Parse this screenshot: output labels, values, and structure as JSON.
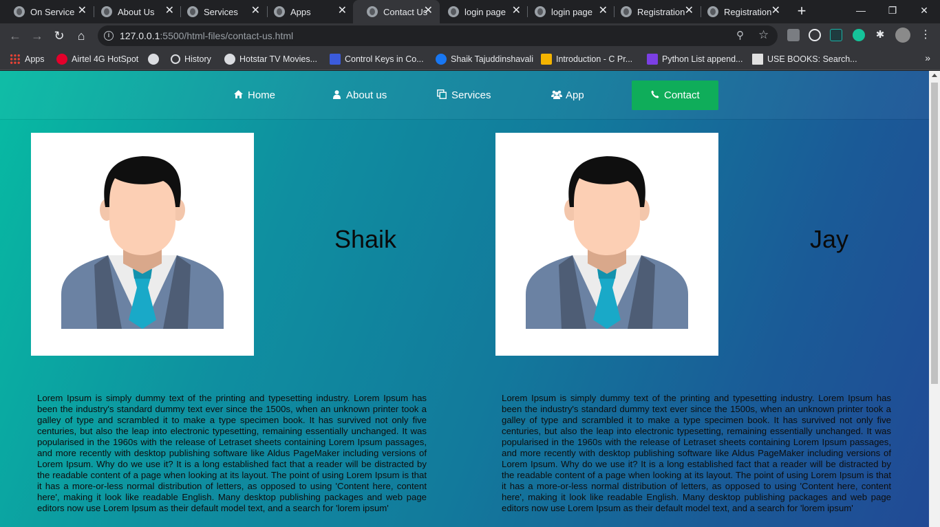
{
  "browser": {
    "tabs": [
      {
        "title": "On Service"
      },
      {
        "title": "About Us"
      },
      {
        "title": "Services"
      },
      {
        "title": "Apps"
      },
      {
        "title": "Contact Us",
        "active": true
      },
      {
        "title": "login page"
      },
      {
        "title": "login page"
      },
      {
        "title": "Registration"
      },
      {
        "title": "Registration"
      }
    ],
    "new_tab": "+",
    "window": {
      "minimize": "—",
      "restore": "❐",
      "close": "✕"
    },
    "url_host": "127.0.0.1",
    "url_path": ":5500/html-files/contact-us.html",
    "bookmarks": [
      {
        "label": "Apps",
        "icon": "apps-grid-icon"
      },
      {
        "label": "Airtel 4G HotSpot",
        "icon": "airtel-icon",
        "color": "#e4002b"
      },
      {
        "label": "",
        "icon": "globe-icon",
        "color": "#9aa0a6"
      },
      {
        "label": "History",
        "icon": "history-icon",
        "color": "#9aa0a6"
      },
      {
        "label": "Hotstar TV Movies...",
        "icon": "globe-icon",
        "color": "#9aa0a6"
      },
      {
        "label": "Control Keys in Co...",
        "icon": "control-keys-icon",
        "color": "#3b5bdb"
      },
      {
        "label": "Shaik Tajuddinshavali",
        "icon": "facebook-icon",
        "color": "#1877f2"
      },
      {
        "label": "Introduction - C Pr...",
        "icon": "javatpoint-icon",
        "color": "#f4b400"
      },
      {
        "label": "Python List append...",
        "icon": "python-list-icon",
        "color": "#7b3fe4"
      },
      {
        "label": "USE BOOKS: Search...",
        "icon": "books-icon",
        "color": "#e0e0e0"
      }
    ],
    "more_bookmarks": "»"
  },
  "site": {
    "nav": [
      {
        "label": "Home",
        "icon": "home-icon"
      },
      {
        "label": "About us",
        "icon": "user-icon"
      },
      {
        "label": "Services",
        "icon": "copy-icon"
      },
      {
        "label": "App",
        "icon": "users-icon"
      },
      {
        "label": "Contact",
        "icon": "phone-icon",
        "active": true
      }
    ],
    "people": [
      {
        "name": "Shaik",
        "bio": "Lorem Ipsum is simply dummy text of the printing and typesetting industry. Lorem Ipsum has been the industry's standard dummy text ever since the 1500s, when an unknown printer took a galley of type and scrambled it to make a type specimen book. It has survived not only five centuries, but also the leap into electronic typesetting, remaining essentially unchanged. It was popularised in the 1960s with the release of Letraset sheets containing Lorem Ipsum passages, and more recently with desktop publishing software like Aldus PageMaker including versions of Lorem Ipsum. Why do we use it? It is a long established fact that a reader will be distracted by the readable content of a page when looking at its layout. The point of using Lorem Ipsum is that it has a more-or-less normal distribution of letters, as opposed to using 'Content here, content here', making it look like readable English. Many desktop publishing packages and web page editors now use Lorem Ipsum as their default model text, and a search for 'lorem ipsum'"
      },
      {
        "name": "Jay",
        "bio": "Lorem Ipsum is simply dummy text of the printing and typesetting industry. Lorem Ipsum has been the industry's standard dummy text ever since the 1500s, when an unknown printer took a galley of type and scrambled it to make a type specimen book. It has survived not only five centuries, but also the leap into electronic typesetting, remaining essentially unchanged. It was popularised in the 1960s with the release of Letraset sheets containing Lorem Ipsum passages, and more recently with desktop publishing software like Aldus PageMaker including versions of Lorem Ipsum. Why do we use it? It is a long established fact that a reader will be distracted by the readable content of a page when looking at its layout. The point of using Lorem Ipsum is that it has a more-or-less normal distribution of letters, as opposed to using 'Content here, content here', making it look like readable English. Many desktop publishing packages and web page editors now use Lorem Ipsum as their default model text, and a search for 'lorem ipsum'"
      }
    ]
  },
  "colors": {
    "active_nav": "#0fad5a",
    "gradient_start": "#07bba3",
    "gradient_end": "#214a95"
  }
}
